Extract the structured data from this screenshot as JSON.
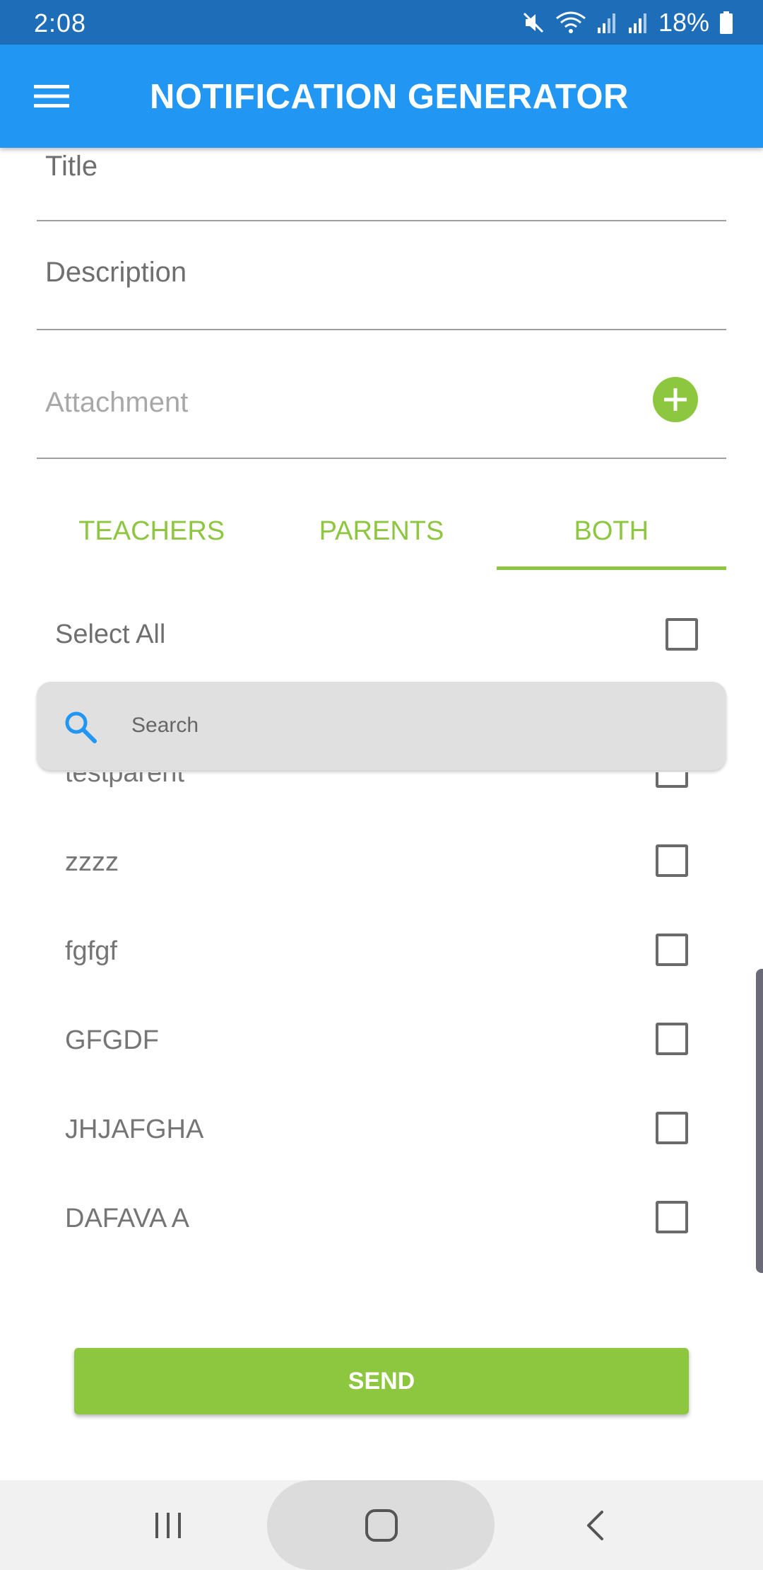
{
  "status_bar": {
    "time": "2:08",
    "battery": "18%",
    "icons": [
      "mute-icon",
      "wifi-icon",
      "signal-icon",
      "signal-icon",
      "battery-icon"
    ]
  },
  "app_bar": {
    "menu_icon": "hamburger-menu-icon",
    "title": "NOTIFICATION GENERATOR",
    "background": "#2196f3"
  },
  "form": {
    "title_label": "Title",
    "description_label": "Description",
    "attachment_label": "Attachment",
    "add_icon": "plus-circle-icon"
  },
  "tabs": [
    {
      "label": "TEACHERS",
      "active": false
    },
    {
      "label": "PARENTS",
      "active": false
    },
    {
      "label": "BOTH",
      "active": true
    }
  ],
  "select_all": {
    "label": "Select All",
    "checked": false
  },
  "search": {
    "placeholder": "Search",
    "value": ""
  },
  "recipients": [
    {
      "name": "testparent",
      "checked": false
    },
    {
      "name": "zzzz",
      "checked": false
    },
    {
      "name": "fgfgf",
      "checked": false
    },
    {
      "name": "GFGDF",
      "checked": false
    },
    {
      "name": "JHJAFGHA",
      "checked": false
    },
    {
      "name": "DAFAVA A",
      "checked": false
    }
  ],
  "send_label": "SEND",
  "colors": {
    "accent_green": "#8dc63f",
    "primary_blue": "#2196f3",
    "status_bar": "#1d6db8"
  },
  "nav_bar": {
    "icons": [
      "recent-apps-icon",
      "home-icon",
      "back-icon"
    ]
  }
}
